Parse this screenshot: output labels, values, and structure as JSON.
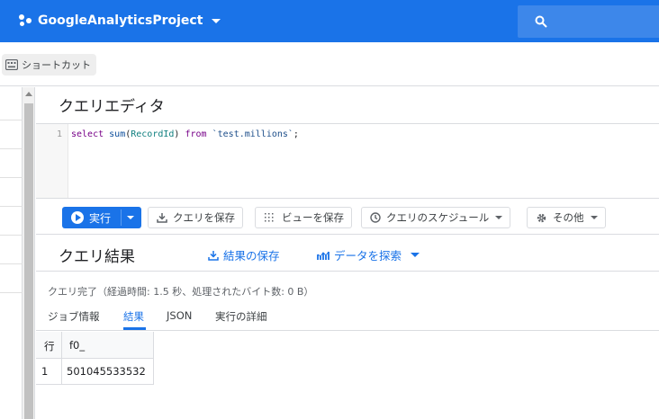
{
  "header": {
    "project_name": "GoogleAnalyticsProject"
  },
  "shortcut": {
    "label": "ショートカット"
  },
  "editor": {
    "title": "クエリエディタ",
    "line_number": "1",
    "code": {
      "kw_select": "select",
      "fn_sum": "sum",
      "open": "(",
      "id_recordid": "RecordId",
      "close": ")",
      "kw_from": "from",
      "table": "`test.millions`",
      "end": ";"
    }
  },
  "toolbar": {
    "run_label": "実行",
    "save_query_label": "クエリを保存",
    "save_view_label": "ビューを保存",
    "schedule_label": "クエリのスケジュール",
    "more_label": "その他"
  },
  "results": {
    "title": "クエリ結果",
    "save_results_label": "結果の保存",
    "explore_label": "データを探索",
    "status": "クエリ完了（経過時間: 1.5 秒、処理されたバイト数: 0 B）",
    "tabs": [
      "ジョブ情報",
      "結果",
      "JSON",
      "実行の詳細"
    ],
    "table": {
      "columns": [
        "行",
        "f0_"
      ],
      "rows": [
        [
          "1",
          "501045533532"
        ]
      ]
    }
  },
  "colors": {
    "accent": "#1a73e8"
  }
}
